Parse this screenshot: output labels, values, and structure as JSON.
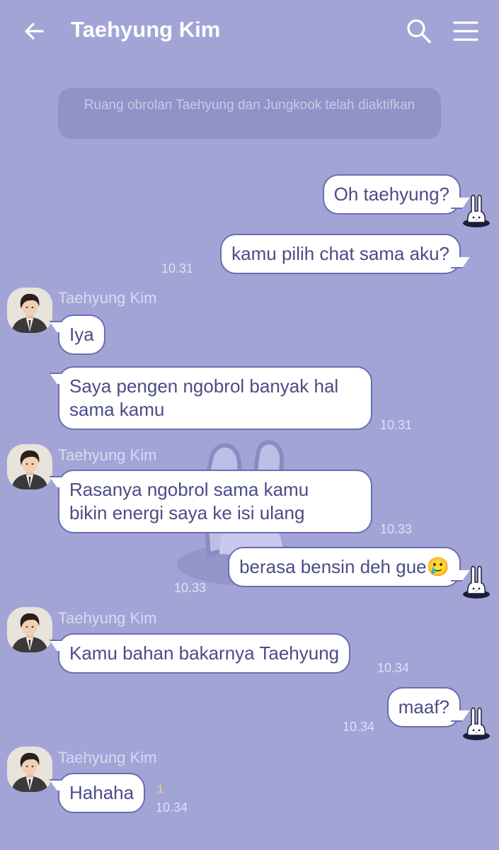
{
  "header": {
    "title": "Taehyung Kim"
  },
  "system_note": "Ruang obrolan Taehyung dan Jungkook telah diaktifkan",
  "messages": [
    {
      "from": "me",
      "text": "Oh taehyung?"
    },
    {
      "from": "me",
      "text": "kamu pilih chat sama aku?",
      "time": "10.31"
    },
    {
      "from": "them",
      "sender": "Taehyung Kim",
      "text": "Iya"
    },
    {
      "from": "them",
      "line1": "Saya pengen ngobrol banyak hal",
      "line2": "sama kamu",
      "time": "10.31"
    },
    {
      "from": "them",
      "sender": "Taehyung Kim",
      "line1": "Rasanya ngobrol sama kamu",
      "line2": "bikin energi saya ke isi ulang",
      "time": "10.33"
    },
    {
      "from": "me",
      "text": "berasa bensin deh gue",
      "emoji": "🥲",
      "time": "10.33"
    },
    {
      "from": "them",
      "sender": "Taehyung Kim",
      "text": "Kamu bahan bakarnya Taehyung",
      "time": "10.34"
    },
    {
      "from": "me",
      "text": "maaf?",
      "time": "10.34"
    },
    {
      "from": "them",
      "sender": "Taehyung Kim",
      "text": "Hahaha",
      "unread": "1",
      "time": "10.34"
    }
  ]
}
